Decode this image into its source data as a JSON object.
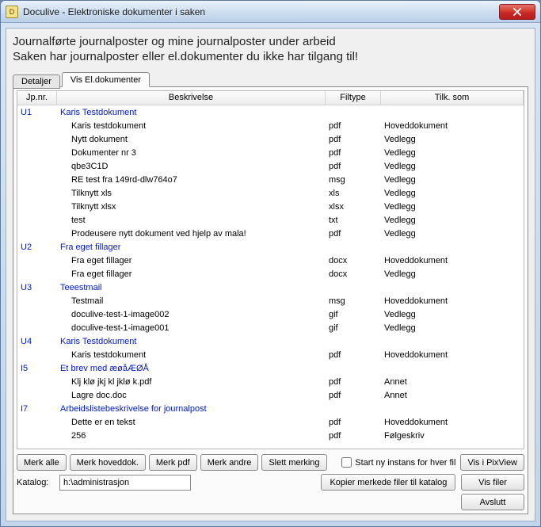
{
  "window": {
    "title": "Doculive - Elektroniske dokumenter i saken"
  },
  "headings": {
    "line1": "Journalførte journalposter og mine journalposter under arbeid",
    "line2": "Saken har journalposter eller el.dokumenter du ikke har tilgang til!"
  },
  "tabs": {
    "detaljer": "Detaljer",
    "vis_el": "Vis El.dokumenter"
  },
  "columns": {
    "jp": "Jp.nr.",
    "desc": "Beskrivelse",
    "filtype": "Filtype",
    "tilk": "Tilk. som"
  },
  "rows": [
    {
      "type": "group",
      "jp": "U1",
      "desc": "Karis Testdokument",
      "ft": "",
      "tk": ""
    },
    {
      "type": "child",
      "jp": "",
      "desc": "Karis testdokument",
      "ft": "pdf",
      "tk": "Hoveddokument"
    },
    {
      "type": "child",
      "jp": "",
      "desc": "Nytt dokument",
      "ft": "pdf",
      "tk": "Vedlegg"
    },
    {
      "type": "child",
      "jp": "",
      "desc": "Dokumenter nr 3",
      "ft": "pdf",
      "tk": "Vedlegg"
    },
    {
      "type": "child",
      "jp": "",
      "desc": "qbe3C1D",
      "ft": "pdf",
      "tk": "Vedlegg"
    },
    {
      "type": "child",
      "jp": "",
      "desc": "RE test fra 149rd-dlw764o7",
      "ft": "msg",
      "tk": "Vedlegg"
    },
    {
      "type": "child",
      "jp": "",
      "desc": "Tilknytt xls",
      "ft": "xls",
      "tk": "Vedlegg"
    },
    {
      "type": "child",
      "jp": "",
      "desc": "Tilknytt xlsx",
      "ft": "xlsx",
      "tk": "Vedlegg"
    },
    {
      "type": "child",
      "jp": "",
      "desc": "test",
      "ft": "txt",
      "tk": "Vedlegg"
    },
    {
      "type": "child",
      "jp": "",
      "desc": "Prodeusere nytt dokument ved hjelp av mala!",
      "ft": "pdf",
      "tk": "Vedlegg"
    },
    {
      "type": "group",
      "jp": "U2",
      "desc": "Fra eget fillager",
      "ft": "",
      "tk": ""
    },
    {
      "type": "child",
      "jp": "",
      "desc": "Fra eget fillager",
      "ft": "docx",
      "tk": "Hoveddokument"
    },
    {
      "type": "child",
      "jp": "",
      "desc": "Fra eget fillager",
      "ft": "docx",
      "tk": "Vedlegg"
    },
    {
      "type": "group",
      "jp": "U3",
      "desc": "Teeestmail",
      "ft": "",
      "tk": ""
    },
    {
      "type": "child",
      "jp": "",
      "desc": "Testmail",
      "ft": "msg",
      "tk": "Hoveddokument"
    },
    {
      "type": "child",
      "jp": "",
      "desc": "doculive-test-1-image002",
      "ft": "gif",
      "tk": "Vedlegg"
    },
    {
      "type": "child",
      "jp": "",
      "desc": "doculive-test-1-image001",
      "ft": "gif",
      "tk": "Vedlegg"
    },
    {
      "type": "group",
      "jp": "U4",
      "desc": "Karis Testdokument",
      "ft": "",
      "tk": ""
    },
    {
      "type": "child",
      "jp": "",
      "desc": "Karis testdokument",
      "ft": "pdf",
      "tk": "Hoveddokument"
    },
    {
      "type": "group",
      "jp": "I5",
      "desc": "Et brev med æøåÆØÅ",
      "ft": "",
      "tk": ""
    },
    {
      "type": "child",
      "jp": "",
      "desc": "Klj klø jkj kl jklø k.pdf",
      "ft": "pdf",
      "tk": "Annet"
    },
    {
      "type": "child",
      "jp": "",
      "desc": "Lagre doc.doc",
      "ft": "pdf",
      "tk": "Annet"
    },
    {
      "type": "group",
      "jp": "I7",
      "desc": "Arbeidslistebeskrivelse for journalpost",
      "ft": "",
      "tk": ""
    },
    {
      "type": "child",
      "jp": "",
      "desc": "Dette er en tekst",
      "ft": "pdf",
      "tk": "Hoveddokument"
    },
    {
      "type": "child",
      "jp": "",
      "desc": "256",
      "ft": "pdf",
      "tk": "Følgeskriv"
    }
  ],
  "buttons": {
    "merk_alle": "Merk alle",
    "merk_hoveddok": "Merk hoveddok.",
    "merk_pdf": "Merk pdf",
    "merk_andre": "Merk andre",
    "slett_merking": "Slett merking",
    "vis_pixview": "Vis i PixView",
    "kopier": "Kopier merkede filer til katalog",
    "vis_filer": "Vis filer",
    "avslutt": "Avslutt"
  },
  "checkbox": {
    "start_ny": "Start ny instans for hver fil"
  },
  "katalog": {
    "label": "Katalog:",
    "value": "h:\\administrasjon"
  }
}
